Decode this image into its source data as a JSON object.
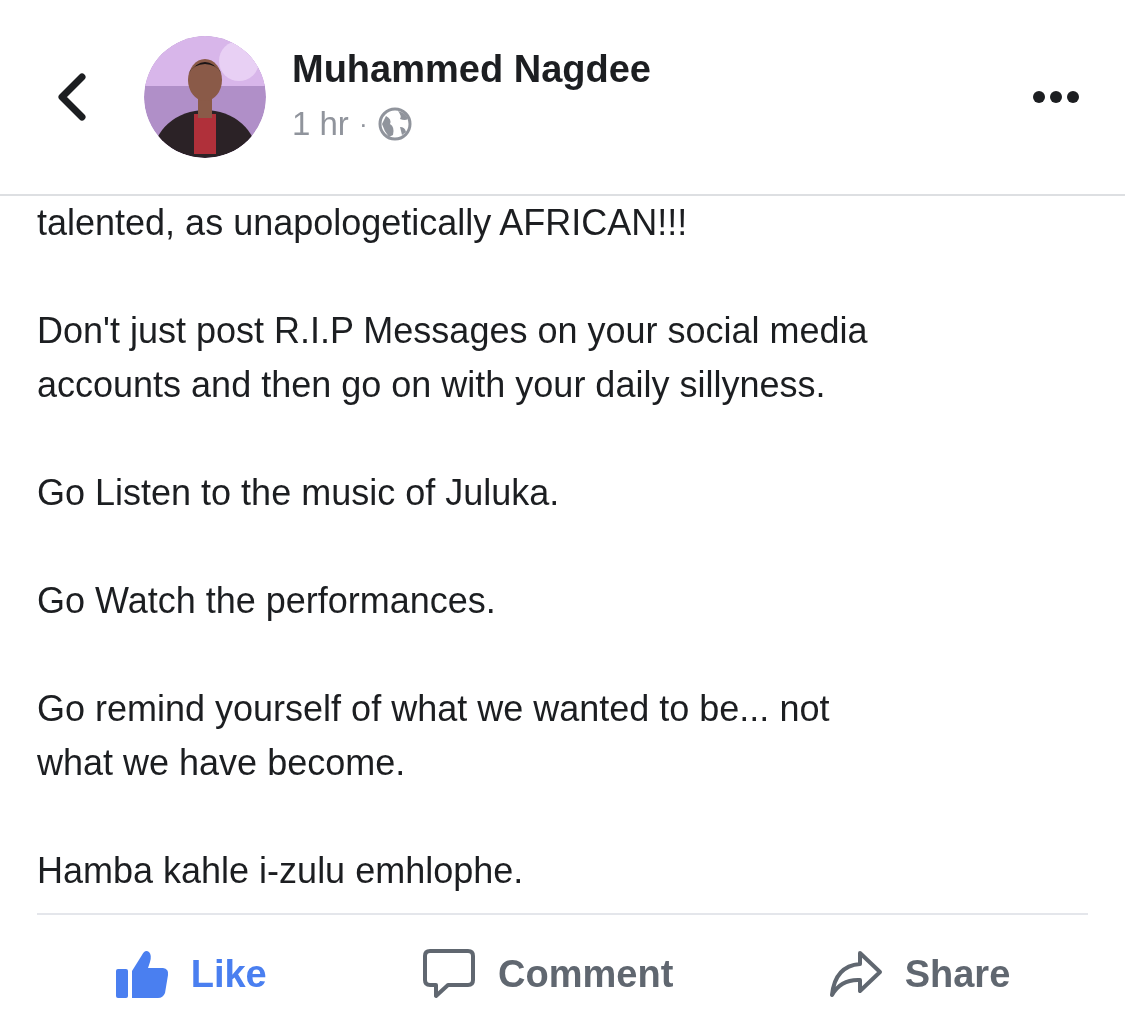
{
  "header": {
    "name": "Muhammed Nagdee",
    "time": "1 hr",
    "separator": "·"
  },
  "post": {
    "paragraphs": [
      {
        "lines": [
          "talented, as unapologetically AFRICAN!!!"
        ]
      },
      {
        "lines": [
          "Don't just post R.I.P Messages on your social media",
          "accounts and then go on with your daily sillyness."
        ]
      },
      {
        "lines": [
          "Go Listen to the music of Juluka."
        ]
      },
      {
        "lines": [
          "Go Watch the performances."
        ]
      },
      {
        "lines": [
          "Go remind yourself of what we wanted to be... not",
          "what we have become."
        ]
      },
      {
        "lines": [
          "Hamba kahle i-zulu emhlophe."
        ]
      }
    ]
  },
  "actions": [
    {
      "kind": "like",
      "label": "Like",
      "selected": true
    },
    {
      "kind": "comment",
      "label": "Comment",
      "selected": false
    },
    {
      "kind": "share",
      "label": "Share",
      "selected": false
    }
  ]
}
